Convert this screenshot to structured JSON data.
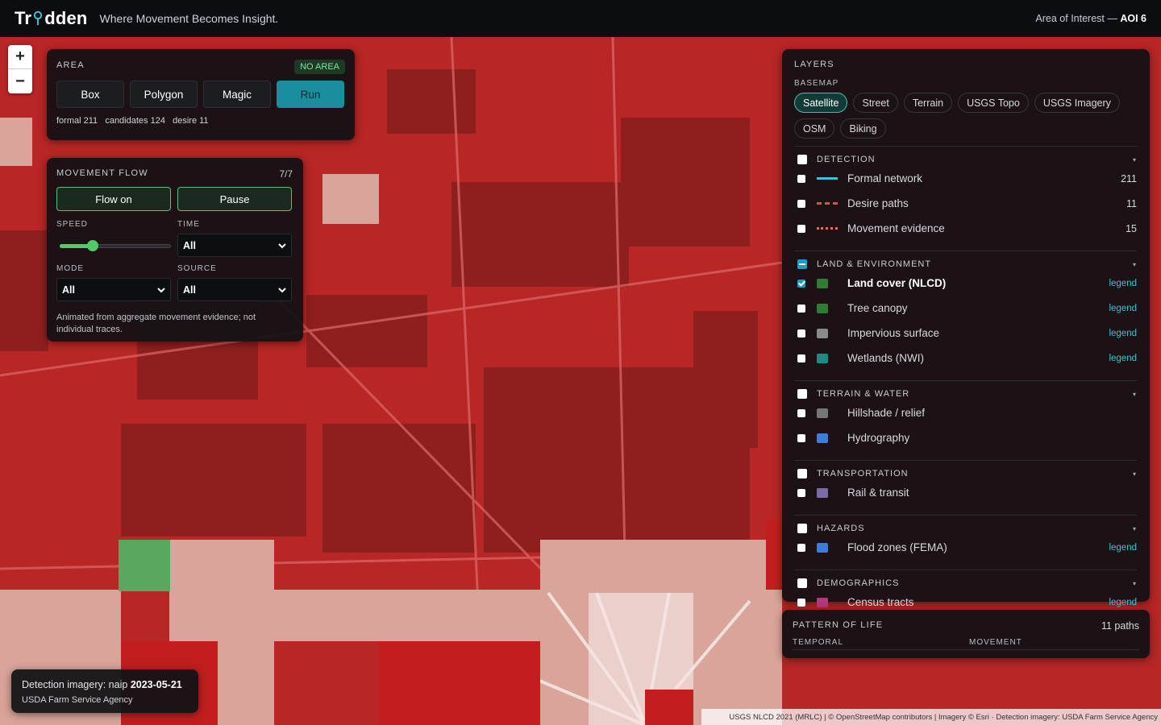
{
  "brand": {
    "logo_left": "Tr",
    "logo_right": "dden",
    "tagline": "Where Movement Becomes Insight."
  },
  "aoi": {
    "prefix": "Area of Interest —",
    "name": "AOI 6"
  },
  "zoom": {
    "in": "+",
    "out": "−"
  },
  "area": {
    "title": "AREA",
    "badge": "NO AREA",
    "buttons": [
      "Box",
      "Polygon",
      "Magic",
      "Run"
    ],
    "stats": "formal 211   candidates 124   desire 11"
  },
  "movement": {
    "title": "MOVEMENT FLOW",
    "count": "7/7",
    "flow_on": "Flow on",
    "pause": "Pause",
    "speed_label": "SPEED",
    "speed_fraction": 0.3,
    "time_label": "TIME",
    "time_value": "All",
    "mode_label": "MODE",
    "mode_value": "All",
    "source_label": "SOURCE",
    "source_value": "All",
    "note": "Animated from aggregate movement evidence; not individual traces."
  },
  "layers": {
    "title": "LAYERS",
    "basemap_label": "BASEMAP",
    "basemaps": [
      "Satellite",
      "Street",
      "Terrain",
      "USGS Topo",
      "USGS Imagery",
      "OSM",
      "Biking"
    ],
    "active_basemap": "Satellite",
    "legend_text": "legend",
    "groups": [
      {
        "name": "DETECTION",
        "items": [
          {
            "label": "Formal network",
            "count": "211",
            "color": "#3ec2d6",
            "style": "solid"
          },
          {
            "label": "Desire paths",
            "count": "11",
            "color": "#e84a4a",
            "style": "dashed"
          },
          {
            "label": "Movement evidence",
            "count": "15",
            "color": "#e8704a",
            "style": "dotted"
          }
        ]
      },
      {
        "name": "LAND & ENVIRONMENT",
        "items": [
          {
            "label": "Land cover (NLCD)",
            "color": "#2e7d32",
            "checked": true,
            "legend": true
          },
          {
            "label": "Tree canopy",
            "color": "#2e7d32",
            "legend": true
          },
          {
            "label": "Impervious surface",
            "color": "#8a8a8a",
            "legend": true
          },
          {
            "label": "Wetlands (NWI)",
            "color": "#1f8a84",
            "legend": true
          }
        ]
      },
      {
        "name": "TERRAIN & WATER",
        "items": [
          {
            "label": "Hillshade / relief",
            "color": "#777777"
          },
          {
            "label": "Hydrography",
            "color": "#3b7dd8"
          }
        ]
      },
      {
        "name": "TRANSPORTATION",
        "items": [
          {
            "label": "Rail & transit",
            "color": "#7a6aa8"
          }
        ]
      },
      {
        "name": "HAZARDS",
        "items": [
          {
            "label": "Flood zones (FEMA)",
            "color": "#3b7dd8",
            "legend": true
          }
        ]
      },
      {
        "name": "DEMOGRAPHICS",
        "items": [
          {
            "label": "Census tracts",
            "color": "#b03a7a",
            "legend": true
          }
        ]
      }
    ]
  },
  "pattern": {
    "title": "PATTERN OF LIFE",
    "paths": "11 paths",
    "temporal": "TEMPORAL",
    "movement": "MOVEMENT"
  },
  "imagery": {
    "prefix": "Detection imagery: naip",
    "date": "2023-05-21",
    "agency": "USDA Farm Service Agency"
  },
  "attribution": "USGS NLCD 2021 (MRLC) | © OpenStreetMap contributors | Imagery © Esri · Detection imagery: USDA Farm Service Agency",
  "colors": {
    "accent": "#1a8e9c",
    "flow": "#4fcc6a",
    "overlay_red": "#d42a2a",
    "overlay_green": "#3fa04a"
  }
}
